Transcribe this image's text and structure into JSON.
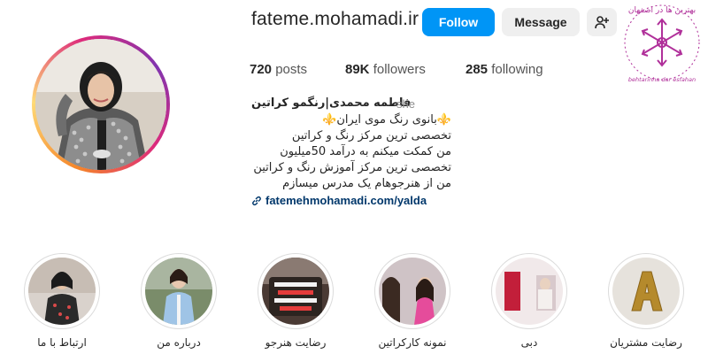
{
  "profile": {
    "username": "fateme.mohamadi.ir",
    "follow_label": "Follow",
    "message_label": "Message",
    "add_user_icon": "person-add-icon"
  },
  "stats": {
    "posts": {
      "value": "720",
      "label": "posts"
    },
    "followers": {
      "value": "89K",
      "label": "followers"
    },
    "following": {
      "value": "285",
      "label": "following"
    }
  },
  "bio": {
    "full_name": "فاطمه محمدی|رنگمو کراتین",
    "pronoun": "she",
    "lines": [
      "⚜️بانوی رنگ موی ایران⚜️",
      "تخصصی ترین مرکز رنگ و کراتین",
      "من کمکت میکنم به درآمد 50میلیون",
      "تخصصی ترین مرکز آموزش رنگ و کراتین",
      "من از هنرجوهام یک مدرس میسازم"
    ],
    "link": "fatemehmohamadi.com/yalda",
    "link_icon": "link-icon"
  },
  "highlights": [
    {
      "label": "رضایت مشتریان",
      "icon": "gold-letter-a"
    },
    {
      "label": "دبی",
      "icon": "dubai-salon-photo"
    },
    {
      "label": "نمونه کارکراتین",
      "icon": "keratin-sample-photo"
    },
    {
      "label": "رضایت هنرجو",
      "icon": "student-review-photo"
    },
    {
      "label": "درباره من",
      "icon": "about-me-photo"
    },
    {
      "label": "ارتباط با ما",
      "icon": "contact-photo"
    }
  ],
  "watermark": {
    "text": "بهترین ها در اصفهان",
    "latin": "behtarinha dar esfahan",
    "color": "#b0309a"
  },
  "colors": {
    "follow_button": "#0095f6",
    "link": "#00376b",
    "secondary_button": "#efefef"
  }
}
